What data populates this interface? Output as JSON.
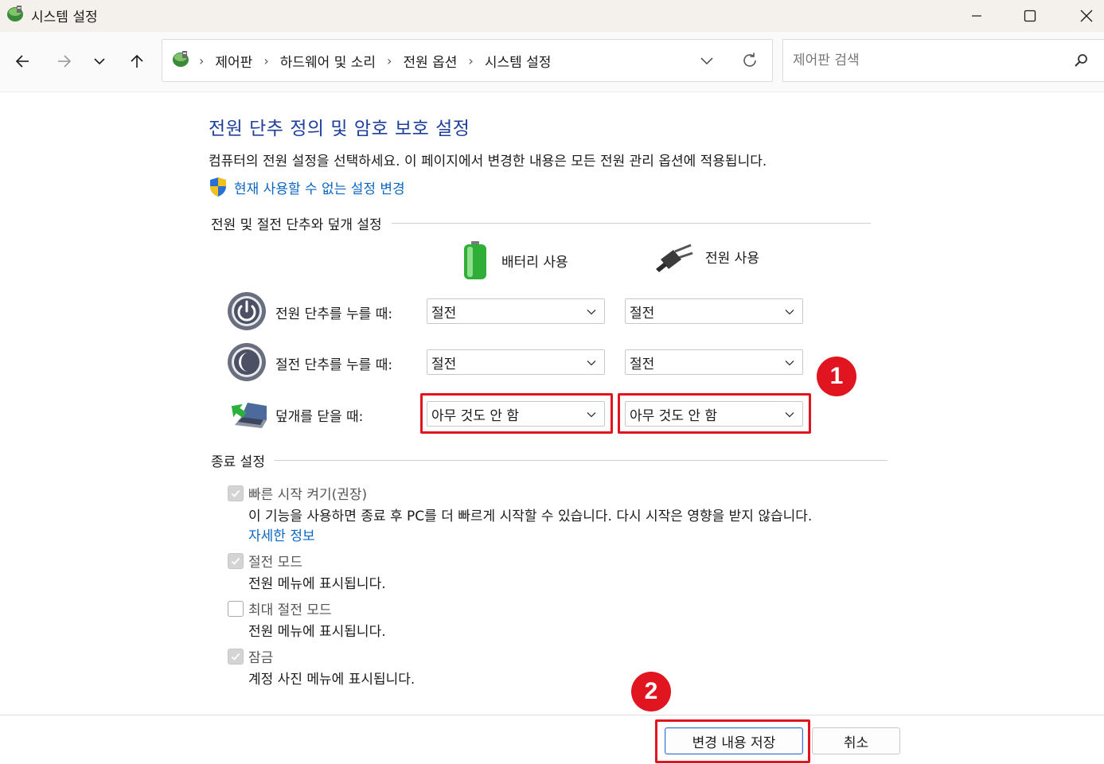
{
  "window": {
    "title": "시스템 설정",
    "controls": [
      "minimize-icon",
      "maximize-icon",
      "close-icon"
    ]
  },
  "nav": {
    "buttons": [
      "arrow-left-icon",
      "arrow-right-icon",
      "chevron-down-icon",
      "arrow-up-icon"
    ],
    "breadcrumbs": [
      "제어판",
      "하드웨어 및 소리",
      "전원 옵션",
      "시스템 설정"
    ],
    "separator": "›",
    "search_placeholder": "제어판 검색"
  },
  "main": {
    "title": "전원 단추 정의 및 암호 보호 설정",
    "description": "컴퓨터의 전원 설정을 선택하세요. 이 페이지에서 변경한 내용은 모든 전원 관리 옵션에 적용됩니다.",
    "uac_link": "현재 사용할 수 없는 설정 변경",
    "power_section": {
      "heading": "전원 및 절전 단추와 덮개 설정",
      "columns": {
        "battery": "배터리 사용",
        "plugged": "전원 사용"
      },
      "rows": [
        {
          "label": "전원 단추를 누를 때:",
          "battery": "절전",
          "plugged": "절전",
          "icon": "power-button-icon"
        },
        {
          "label": "절전 단추를 누를 때:",
          "battery": "절전",
          "plugged": "절전",
          "icon": "sleep-button-icon"
        },
        {
          "label": "덮개를 닫을 때:",
          "battery": "아무 것도 안 함",
          "plugged": "아무 것도 안 함",
          "icon": "laptop-lid-icon"
        }
      ]
    },
    "shutdown_section": {
      "heading": "종료 설정",
      "options": [
        {
          "title": "빠른 시작 켜기(권장)",
          "description": "이 기능을 사용하면 종료 후 PC를 더 빠르게 시작할 수 있습니다. 다시 시작은 영향을 받지 않습니다.",
          "link": "자세한 정보",
          "checked": true,
          "disabled": true
        },
        {
          "title": "절전 모드",
          "description": "전원 메뉴에 표시됩니다.",
          "checked": true,
          "disabled": true
        },
        {
          "title": "최대 절전 모드",
          "description": "전원 메뉴에 표시됩니다.",
          "checked": false,
          "disabled": true
        },
        {
          "title": "잠금",
          "description": "계정 사진 메뉴에 표시됩니다.",
          "checked": true,
          "disabled": true
        }
      ]
    }
  },
  "footer": {
    "save": "변경 내용 저장",
    "cancel": "취소"
  },
  "annotations": {
    "badge1": "1",
    "badge2": "2",
    "color": "#e0151f"
  }
}
